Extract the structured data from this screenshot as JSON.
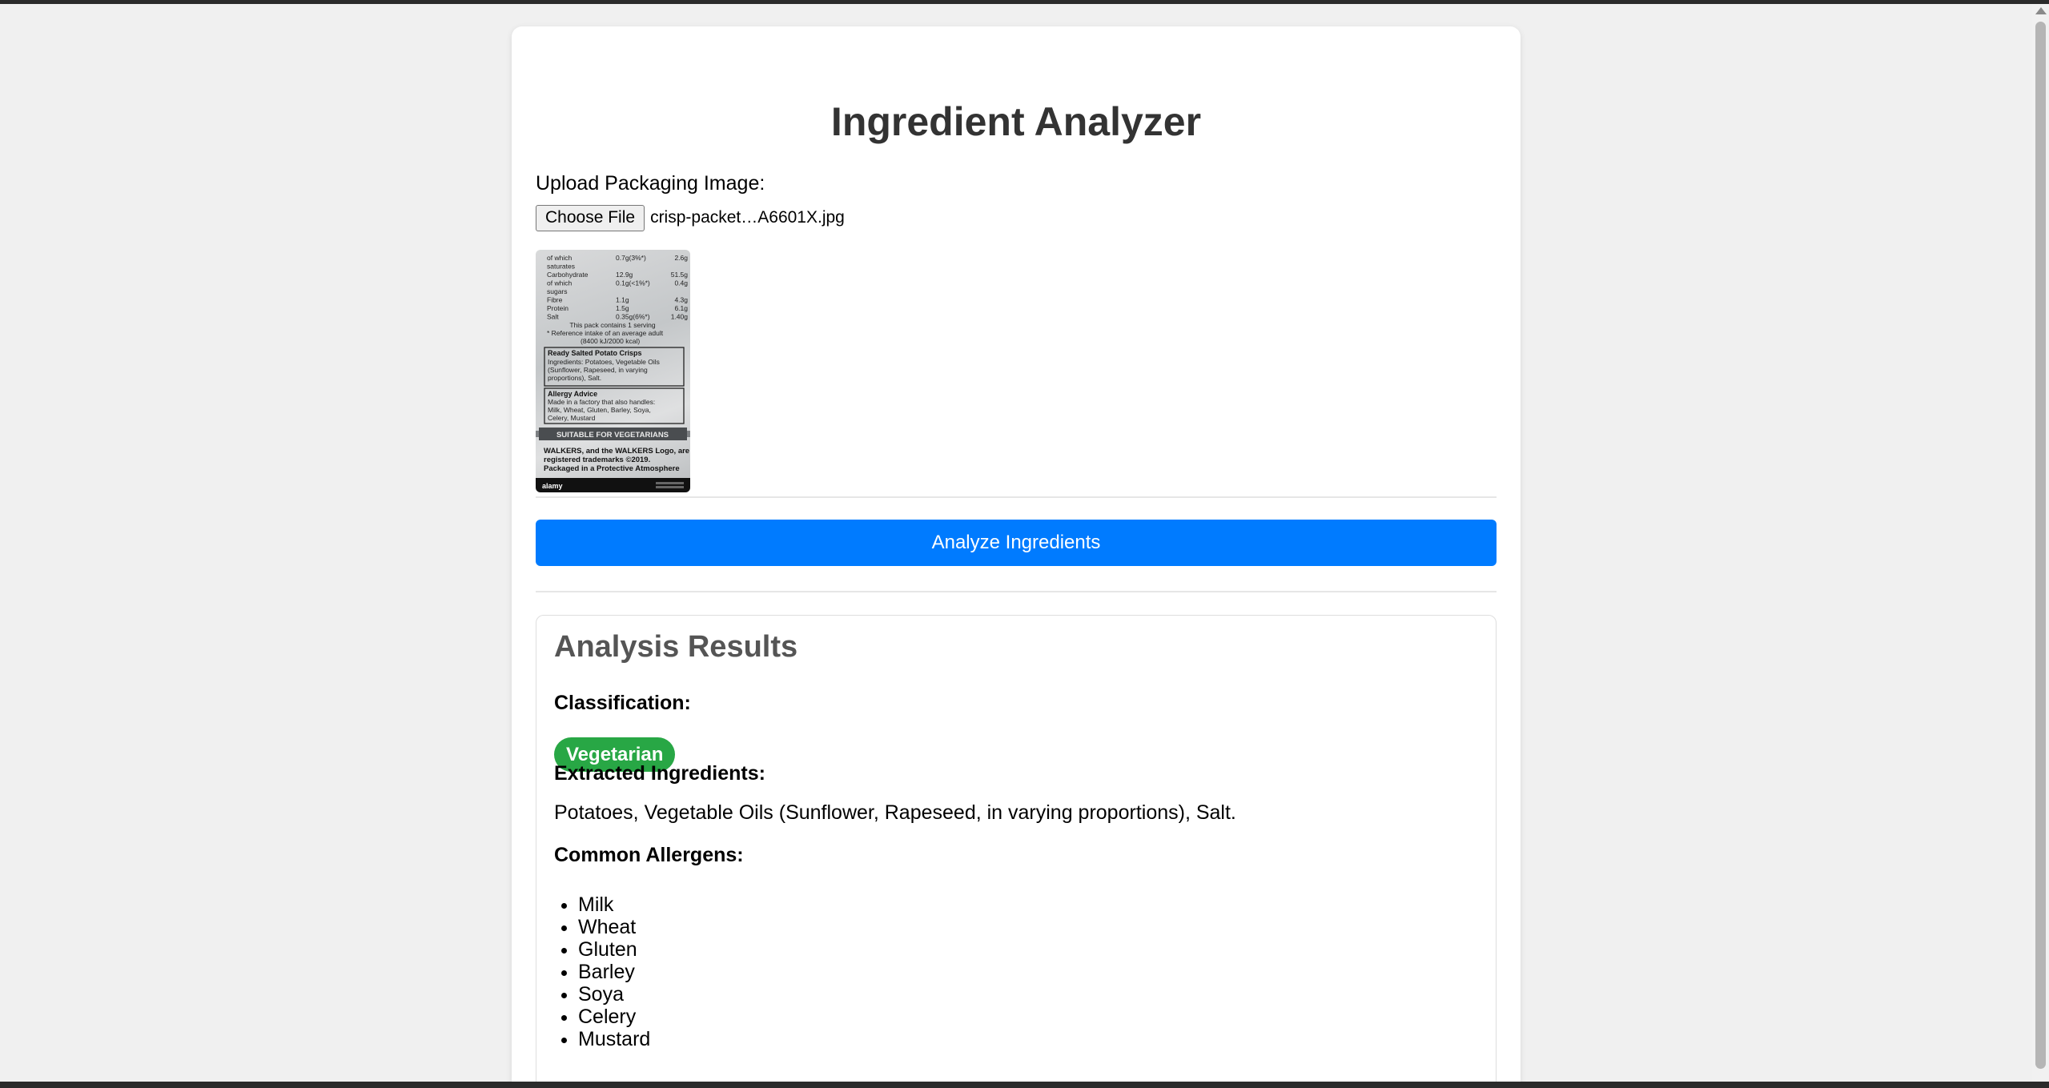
{
  "app": {
    "title": "Ingredient Analyzer"
  },
  "upload": {
    "label": "Upload Packaging Image:",
    "button_label": "Choose File",
    "file_name": "crisp-packet…A6601X.jpg"
  },
  "preview": {
    "nutrition_rows": [
      [
        "of which",
        "0.7g(3%*)",
        "2.6g"
      ],
      [
        "saturates",
        "",
        ""
      ],
      [
        "Carbohydrate",
        "12.9g",
        "51.5g"
      ],
      [
        "of which",
        "0.1g(<1%*)",
        "0.4g"
      ],
      [
        "sugars",
        "",
        ""
      ],
      [
        "Fibre",
        "1.1g",
        "4.3g"
      ],
      [
        "Protein",
        "1.5g",
        "6.1g"
      ],
      [
        "Salt",
        "0.35g(6%*)",
        "1.40g"
      ]
    ],
    "serving_note": "This pack contains 1 serving",
    "reference_note": "* Reference intake of an average adult",
    "energy_note": "(8400 kJ/2000 kcal)",
    "product_heading": "Ready Salted Potato Crisps",
    "ingredients_lines": [
      "Ingredients: Potatoes, Vegetable Oils",
      "(Sunflower, Rapeseed, in varying",
      "proportions), Salt."
    ],
    "allergy_heading": "Allergy Advice",
    "allergy_lines": [
      "Made in a factory that also handles:",
      "Milk, Wheat, Gluten, Barley, Soya,",
      "Celery, Mustard"
    ],
    "vegetarian_banner": "SUITABLE FOR VEGETARIANS",
    "trademark_lines": [
      "WALKERS, and the WALKERS Logo, are",
      "registered trademarks ©2019.",
      "Packaged in a Protective Atmosphere"
    ],
    "watermark": "alamy"
  },
  "actions": {
    "analyze_label": "Analyze Ingredients"
  },
  "results": {
    "title": "Analysis Results",
    "classification_label": "Classification:",
    "classification_value": "Vegetarian",
    "ingredients_label": "Extracted Ingredients:",
    "ingredients_text": "Potatoes, Vegetable Oils (Sunflower, Rapeseed, in varying proportions), Salt.",
    "allergens_label": "Common Allergens:",
    "allergens": [
      "Milk",
      "Wheat",
      "Gluten",
      "Barley",
      "Soya",
      "Celery",
      "Mustard"
    ]
  },
  "colors": {
    "primary_button": "#007bff",
    "badge_vegetarian": "#28a745",
    "page_background": "#f0f0f0",
    "card_background": "#ffffff"
  }
}
